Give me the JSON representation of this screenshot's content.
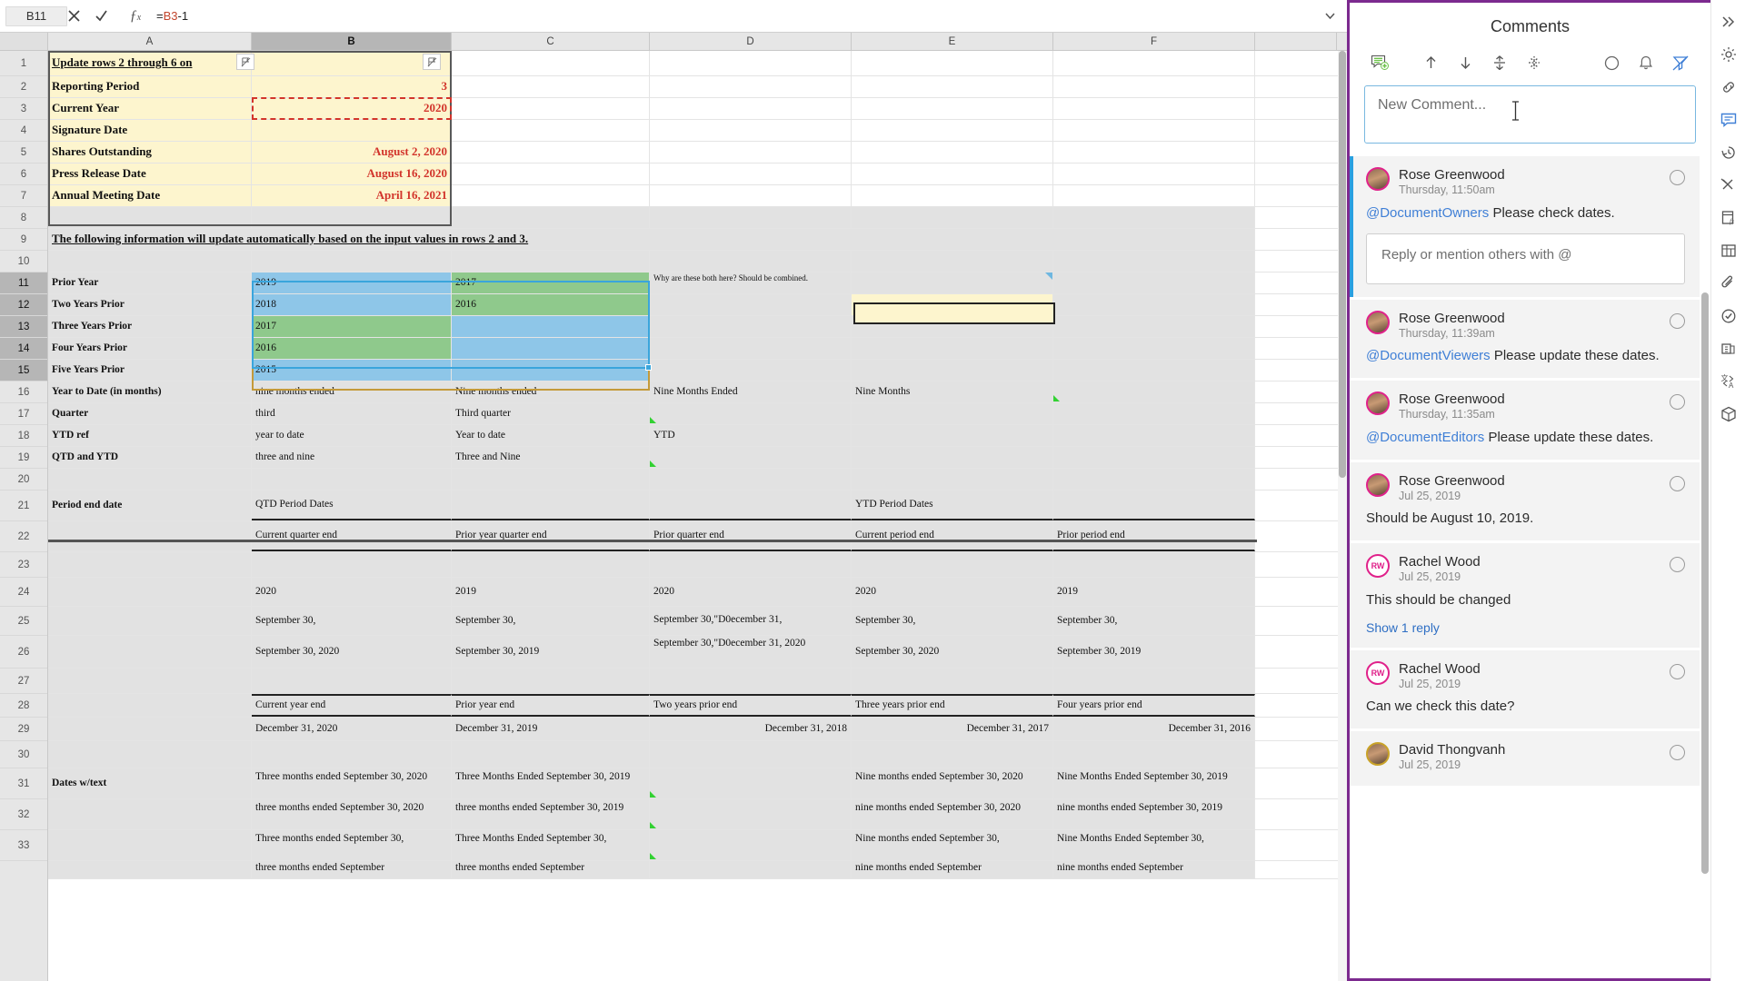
{
  "formula_bar": {
    "name_box": "B11",
    "cancel_icon": "cancel-x-icon",
    "accept_icon": "accept-check-icon",
    "function_icon": "fx-icon",
    "formula_prefix": "=",
    "formula_ref": "B3",
    "formula_suffix": "-1",
    "expand_icon": "chevron-down-icon"
  },
  "columns": [
    "A",
    "B",
    "C",
    "D",
    "E",
    "F"
  ],
  "selected_column": "B",
  "rows": [
    "1",
    "2",
    "3",
    "4",
    "5",
    "6",
    "7",
    "8",
    "9",
    "10",
    "11",
    "12",
    "13",
    "14",
    "15",
    "16",
    "17",
    "18",
    "19",
    "20",
    "21",
    "22",
    "23",
    "24",
    "25",
    "26",
    "27",
    "28",
    "29",
    "30",
    "31",
    "32",
    "33"
  ],
  "selected_rows": [
    "11",
    "12",
    "13",
    "14",
    "15"
  ],
  "sheet": {
    "r1": {
      "a": "Update rows 2 through 6 on",
      "b": ""
    },
    "r2": {
      "a": "Reporting Period",
      "b": "3"
    },
    "r3": {
      "a": "Current Year",
      "b": "2020"
    },
    "r4": {
      "a": "Signature Date",
      "b": ""
    },
    "r5": {
      "a": "Shares Outstanding",
      "b": "August 2, 2020"
    },
    "r6": {
      "a": "Press Release Date",
      "b": "August 16, 2020"
    },
    "r7": {
      "a": "Annual Meeting Date",
      "b": "April 16, 2021"
    },
    "r9": {
      "a": "The following information will update automatically based on the input values in rows 2 and 3."
    },
    "r11": {
      "a": "Prior Year",
      "b": "2019",
      "c": "2017",
      "d": "Why are these both here?  Should be combined."
    },
    "r12": {
      "a": "Two Years Prior",
      "b": "2018",
      "c": "2016"
    },
    "r13": {
      "a": "Three Years Prior",
      "b": "2017",
      "c": ""
    },
    "r14": {
      "a": "Four Years Prior",
      "b": "2016",
      "c": ""
    },
    "r15": {
      "a": "Five Years Prior",
      "b": "2015",
      "c": ""
    },
    "r16": {
      "a": "Year to Date (in months)",
      "b": "nine months ended",
      "c": "Nine months ended",
      "d": "Nine Months Ended",
      "e": "Nine Months"
    },
    "r17": {
      "a": "Quarter",
      "b": "third",
      "c": "Third quarter"
    },
    "r18": {
      "a": "YTD ref",
      "b": "year to date",
      "c": "Year to date",
      "d": "YTD"
    },
    "r19": {
      "a": "QTD and YTD",
      "b": "three and nine",
      "c": "Three and Nine"
    },
    "r21": {
      "a": "Period end date",
      "b": "QTD Period Dates",
      "e": "YTD Period Dates"
    },
    "r22": {
      "b": "Current quarter end",
      "c": "Prior year quarter end",
      "d": "Prior quarter end",
      "e": "Current period end",
      "f": "Prior period end"
    },
    "r24": {
      "b": "2020",
      "c": "2019",
      "d": "2020",
      "e": "2020",
      "f": "2019"
    },
    "r25": {
      "b": "September 30,",
      "c": "September 30,",
      "d": "September 30,\"D0ecember 31,",
      "e": "September 30,",
      "f": "September 30,"
    },
    "r26": {
      "b": "September 30, 2020",
      "c": "September 30, 2019",
      "d": "September 30,\"D0ecember 31, 2020",
      "e": "September 30, 2020",
      "f": "September 30, 2019"
    },
    "r28": {
      "b": "Current year end",
      "c": "Prior year end",
      "d": "Two years prior end",
      "e": "Three years prior end",
      "f": "Four years prior end"
    },
    "r29": {
      "b": "December 31, 2020",
      "c": "December 31, 2019",
      "d": "December 31, 2018",
      "e": "December 31, 2017",
      "f": "December 31, 2016"
    },
    "r31": {
      "a": "Dates w/text",
      "b": "Three months ended September 30, 2020",
      "c": "Three Months Ended September 30, 2019",
      "e": "Nine months ended September 30, 2020",
      "f": "Nine Months Ended September 30, 2019"
    },
    "r32": {
      "b": "three months ended September 30, 2020",
      "c": "three months ended September 30, 2019",
      "e": "nine months ended September 30, 2020",
      "f": "nine months ended September 30, 2019"
    },
    "r33": {
      "b": "Three months ended September 30,",
      "c": "Three Months Ended September 30,",
      "e": "Nine months ended September 30,",
      "f": "Nine Months Ended September 30,"
    },
    "r34": {
      "b": "three months ended September",
      "c": "three months ended September",
      "e": "nine months ended September",
      "f": "nine months ended September"
    }
  },
  "comments_panel": {
    "title": "Comments",
    "toolbar": [
      {
        "name": "new-comment-icon"
      },
      {
        "name": "move-up-icon"
      },
      {
        "name": "move-down-icon"
      },
      {
        "name": "expand-all-icon"
      },
      {
        "name": "collapse-all-icon"
      },
      {
        "name": "resolve-all-icon"
      },
      {
        "name": "notifications-icon"
      },
      {
        "name": "filter-comments-icon"
      }
    ],
    "new_comment_placeholder": "New Comment...",
    "reply_placeholder": "Reply or mention others with @",
    "comments": [
      {
        "author": "Rose Greenwood",
        "date": "Thursday, 11:50am",
        "mention": "@DocumentOwners",
        "text": " Please check dates.",
        "avatar_type": "photo",
        "active": true,
        "has_reply_box": true
      },
      {
        "author": "Rose Greenwood",
        "date": "Thursday, 11:39am",
        "mention": "@DocumentViewers",
        "text": " Please update these dates.",
        "avatar_type": "photo",
        "active": false,
        "has_reply_box": false
      },
      {
        "author": "Rose Greenwood",
        "date": "Thursday, 11:35am",
        "mention": "@DocumentEditors",
        "text": " Please update these dates.",
        "avatar_type": "photo",
        "active": false,
        "has_reply_box": false
      },
      {
        "author": "Rose Greenwood",
        "date": "Jul 25, 2019",
        "mention": "",
        "text": "Should be August 10, 2019.",
        "avatar_type": "photo",
        "active": false,
        "has_reply_box": false
      },
      {
        "author": "Rachel Wood",
        "date": "Jul 25, 2019",
        "mention": "",
        "text": "This should be changed",
        "avatar_type": "initials",
        "initials": "RW",
        "active": false,
        "has_reply_box": false,
        "show_replies": "Show 1 reply"
      },
      {
        "author": "Rachel Wood",
        "date": "Jul 25, 2019",
        "mention": "",
        "text": "Can we check this date?",
        "avatar_type": "initials",
        "initials": "RW",
        "active": false,
        "has_reply_box": false
      },
      {
        "author": "David Thongvanh",
        "date": "Jul 25, 2019",
        "mention": "",
        "text": "",
        "avatar_type": "photo-gold",
        "active": false,
        "has_reply_box": false
      }
    ]
  },
  "rail": [
    {
      "name": "expand-panel-icon"
    },
    {
      "name": "settings-gear-icon"
    },
    {
      "name": "link-icon"
    },
    {
      "name": "comments-panel-icon"
    },
    {
      "name": "history-icon"
    },
    {
      "name": "cut-formula-icon"
    },
    {
      "name": "formula-inspect-icon"
    },
    {
      "name": "table-icon"
    },
    {
      "name": "attachment-icon"
    },
    {
      "name": "validate-check-icon"
    },
    {
      "name": "copy-pages-icon"
    },
    {
      "name": "translate-icon"
    },
    {
      "name": "package-icon"
    }
  ],
  "colors": {
    "panel_border": "#7c2a8f",
    "accent_blue": "#2a9fe0",
    "mention_blue": "#3f7fd6",
    "selection_blue": "#8ec6e8",
    "selection_green": "#8fc98c",
    "header_yellow": "#fdf5ce",
    "value_red": "#d2342b"
  }
}
